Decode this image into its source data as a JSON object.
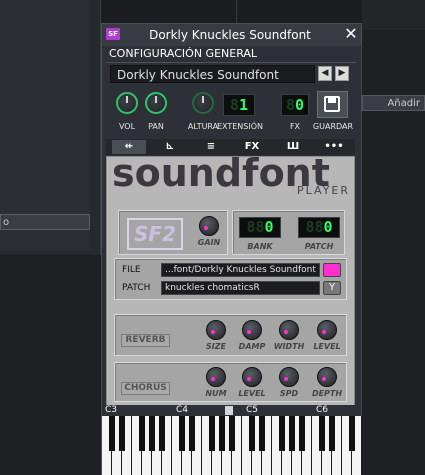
{
  "background": {
    "left_input_value": "o",
    "right_button_label": "Añadir"
  },
  "window": {
    "logo": "SF",
    "title": "Dorkly Knuckles Soundfont",
    "close": "✕"
  },
  "general": {
    "section_label": "CONFIGURACIÓN GENERAL",
    "preset_name": "Dorkly Knuckles Soundfont",
    "prev": "◀",
    "next": "▶"
  },
  "controls": {
    "vol": "VOL",
    "pan": "PAN",
    "altura": "ALTURA",
    "extension": "EXTENSIÓN",
    "extension_value": "1",
    "fx": "FX",
    "fx_value": "0",
    "save": "GUARDAR"
  },
  "tabs": [
    {
      "icon": "arrow-in-icon",
      "glyph": "⇷"
    },
    {
      "icon": "envelope-icon",
      "glyph": "⊾"
    },
    {
      "icon": "lfo-icon",
      "glyph": "≡"
    },
    {
      "icon": "fx-icon",
      "glyph": "FX"
    },
    {
      "icon": "midi-icon",
      "glyph": "Ш"
    },
    {
      "icon": "more-icon",
      "glyph": "•••"
    }
  ],
  "plugin": {
    "brand": "soundfont",
    "subtitle": "PLAYER",
    "sf2_logo": "SF2",
    "gain": "GAIN",
    "bank_label": "BANK",
    "bank_value": "0",
    "patch_label": "PATCH",
    "patch_value": "0",
    "file_label": "FILE",
    "file_value": "...font/Dorkly Knuckles Soundfont",
    "patch_field_label": "PATCH",
    "patch_name": "knuckles chomaticsR",
    "reverb": "REVERB",
    "reverb_knobs": [
      "SIZE",
      "DAMP",
      "WIDTH",
      "LEVEL"
    ],
    "chorus": "CHORUS",
    "chorus_knobs": [
      "NUM",
      "LEVEL",
      "SPD",
      "DEPTH"
    ]
  },
  "keyboard": {
    "octaves": [
      "C3",
      "C4",
      "C5",
      "C6"
    ]
  },
  "colors": {
    "lcd_green": "#2bff6a",
    "knob_ring": "#2dc46a",
    "accent_pink": "#ff2fd0",
    "logo_purple": "#b33ad2"
  }
}
